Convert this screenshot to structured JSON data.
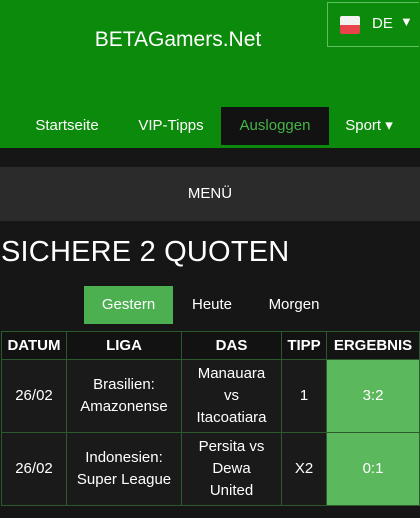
{
  "header": {
    "site_title": "BETAGamers.Net",
    "language": {
      "label": "DE",
      "caret": "▼"
    }
  },
  "nav": {
    "items": [
      {
        "label": "Startseite"
      },
      {
        "label": "VIP-Tipps"
      },
      {
        "label": "Ausloggen"
      },
      {
        "label": "Sport ▾"
      }
    ]
  },
  "menu": {
    "label": "MENÜ"
  },
  "page": {
    "title": "SICHERE 2 QUOTEN"
  },
  "tabs": [
    {
      "label": "Gestern"
    },
    {
      "label": "Heute"
    },
    {
      "label": "Morgen"
    }
  ],
  "table": {
    "headers": [
      "DATUM",
      "LIGA",
      "DAS",
      "TIPP",
      "ERGEBNIS"
    ],
    "rows": [
      {
        "date": "26/02",
        "league": [
          "Brasilien:",
          "Amazonense"
        ],
        "match": [
          "Manauara",
          "vs",
          "Itacoatiara"
        ],
        "tip": "1",
        "result": "3:2"
      },
      {
        "date": "26/02",
        "league": [
          "Indonesien:",
          "Super League"
        ],
        "match": [
          "Persita vs",
          "Dewa",
          "United"
        ],
        "tip": "X2",
        "result": "0:1"
      }
    ]
  },
  "colors": {
    "header_bg": "#0b8a0b",
    "active_nav_text": "#46b446",
    "active_tab_bg": "#4caf50",
    "result_bg": "#5cb85c",
    "page_bg": "#161616"
  }
}
